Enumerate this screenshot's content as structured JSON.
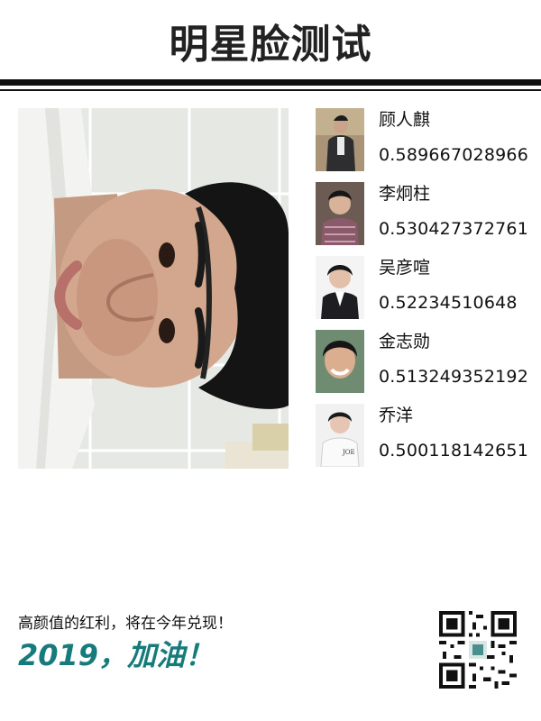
{
  "header": {
    "title": "明星脸测试"
  },
  "photo": {
    "icon": "face-photo"
  },
  "matches": [
    {
      "name": "顾人麒",
      "score": "0.589667028966",
      "icon": "celebrity-portrait"
    },
    {
      "name": "李炯柱",
      "score": "0.530427372761",
      "icon": "celebrity-portrait"
    },
    {
      "name": "吴彦喧",
      "score": "0.52234510648",
      "icon": "celebrity-portrait"
    },
    {
      "name": "金志勋",
      "score": "0.513249352192",
      "icon": "celebrity-portrait"
    },
    {
      "name": "乔洋",
      "score": "0.500118142651",
      "icon": "celebrity-portrait"
    }
  ],
  "footer": {
    "subtitle": "高颜值的红利，将在今年兑现！",
    "slogan": "2019，加油！",
    "accent_color": "#177b7c",
    "qr_icon": "qr-code"
  }
}
